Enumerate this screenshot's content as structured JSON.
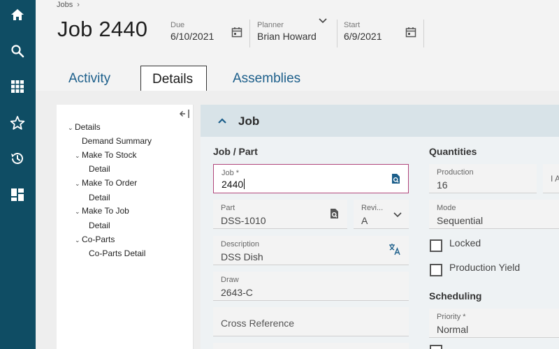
{
  "nav_rail": {
    "icons": [
      "home-icon",
      "search-icon",
      "apps-grid-icon",
      "favorites-star-icon",
      "history-icon",
      "dashboard-icon"
    ],
    "background": "#0f4d64"
  },
  "header": {
    "breadcrumb": "Jobs",
    "breadcrumb_sep": "›",
    "title": "Job 2440",
    "due_label": "Due",
    "due_value": "6/10/2021",
    "planner_label": "Planner",
    "planner_value": "Brian Howard",
    "start_label": "Start",
    "start_value": "6/9/2021"
  },
  "tabs": [
    {
      "label": "Activity",
      "active": false
    },
    {
      "label": "Details",
      "active": true
    },
    {
      "label": "Assemblies",
      "active": false
    }
  ],
  "tree": {
    "items": [
      {
        "label": "Details",
        "caret": "⌄"
      },
      {
        "label": "Demand Summary",
        "caret": ""
      },
      {
        "label": "Make To Stock",
        "caret": "⌄"
      },
      {
        "label": "Detail",
        "caret": ""
      },
      {
        "label": "Make To Order",
        "caret": "⌄"
      },
      {
        "label": "Detail",
        "caret": ""
      },
      {
        "label": "Make To Job",
        "caret": "⌄"
      },
      {
        "label": "Detail",
        "caret": ""
      },
      {
        "label": "Co-Parts",
        "caret": "⌄"
      },
      {
        "label": "Co-Parts Detail",
        "caret": ""
      }
    ]
  },
  "panel": {
    "title": "Job",
    "job_part_heading": "Job / Part",
    "quantities_heading": "Quantities",
    "scheduling_heading": "Scheduling",
    "job_label": "Job *",
    "job_value": "2440",
    "part_label": "Part",
    "part_value": "DSS-1010",
    "revision_label": "Revi...",
    "revision_value": "A",
    "description_label": "Description",
    "description_value": "DSS Dish",
    "draw_label": "Draw",
    "draw_value": "2643-C",
    "cross_reference_placeholder": "Cross Reference",
    "production_label": "Production",
    "production_value": "16",
    "extra_label": "I A",
    "mode_label": "Mode",
    "mode_value": "Sequential",
    "locked_label": "Locked",
    "locked_checked": false,
    "production_yield_label": "Production Yield",
    "production_yield_checked": false,
    "priority_label": "Priority *",
    "priority_value": "Normal",
    "accent_color": "#b0447a",
    "link_color": "#1b5e8a"
  }
}
